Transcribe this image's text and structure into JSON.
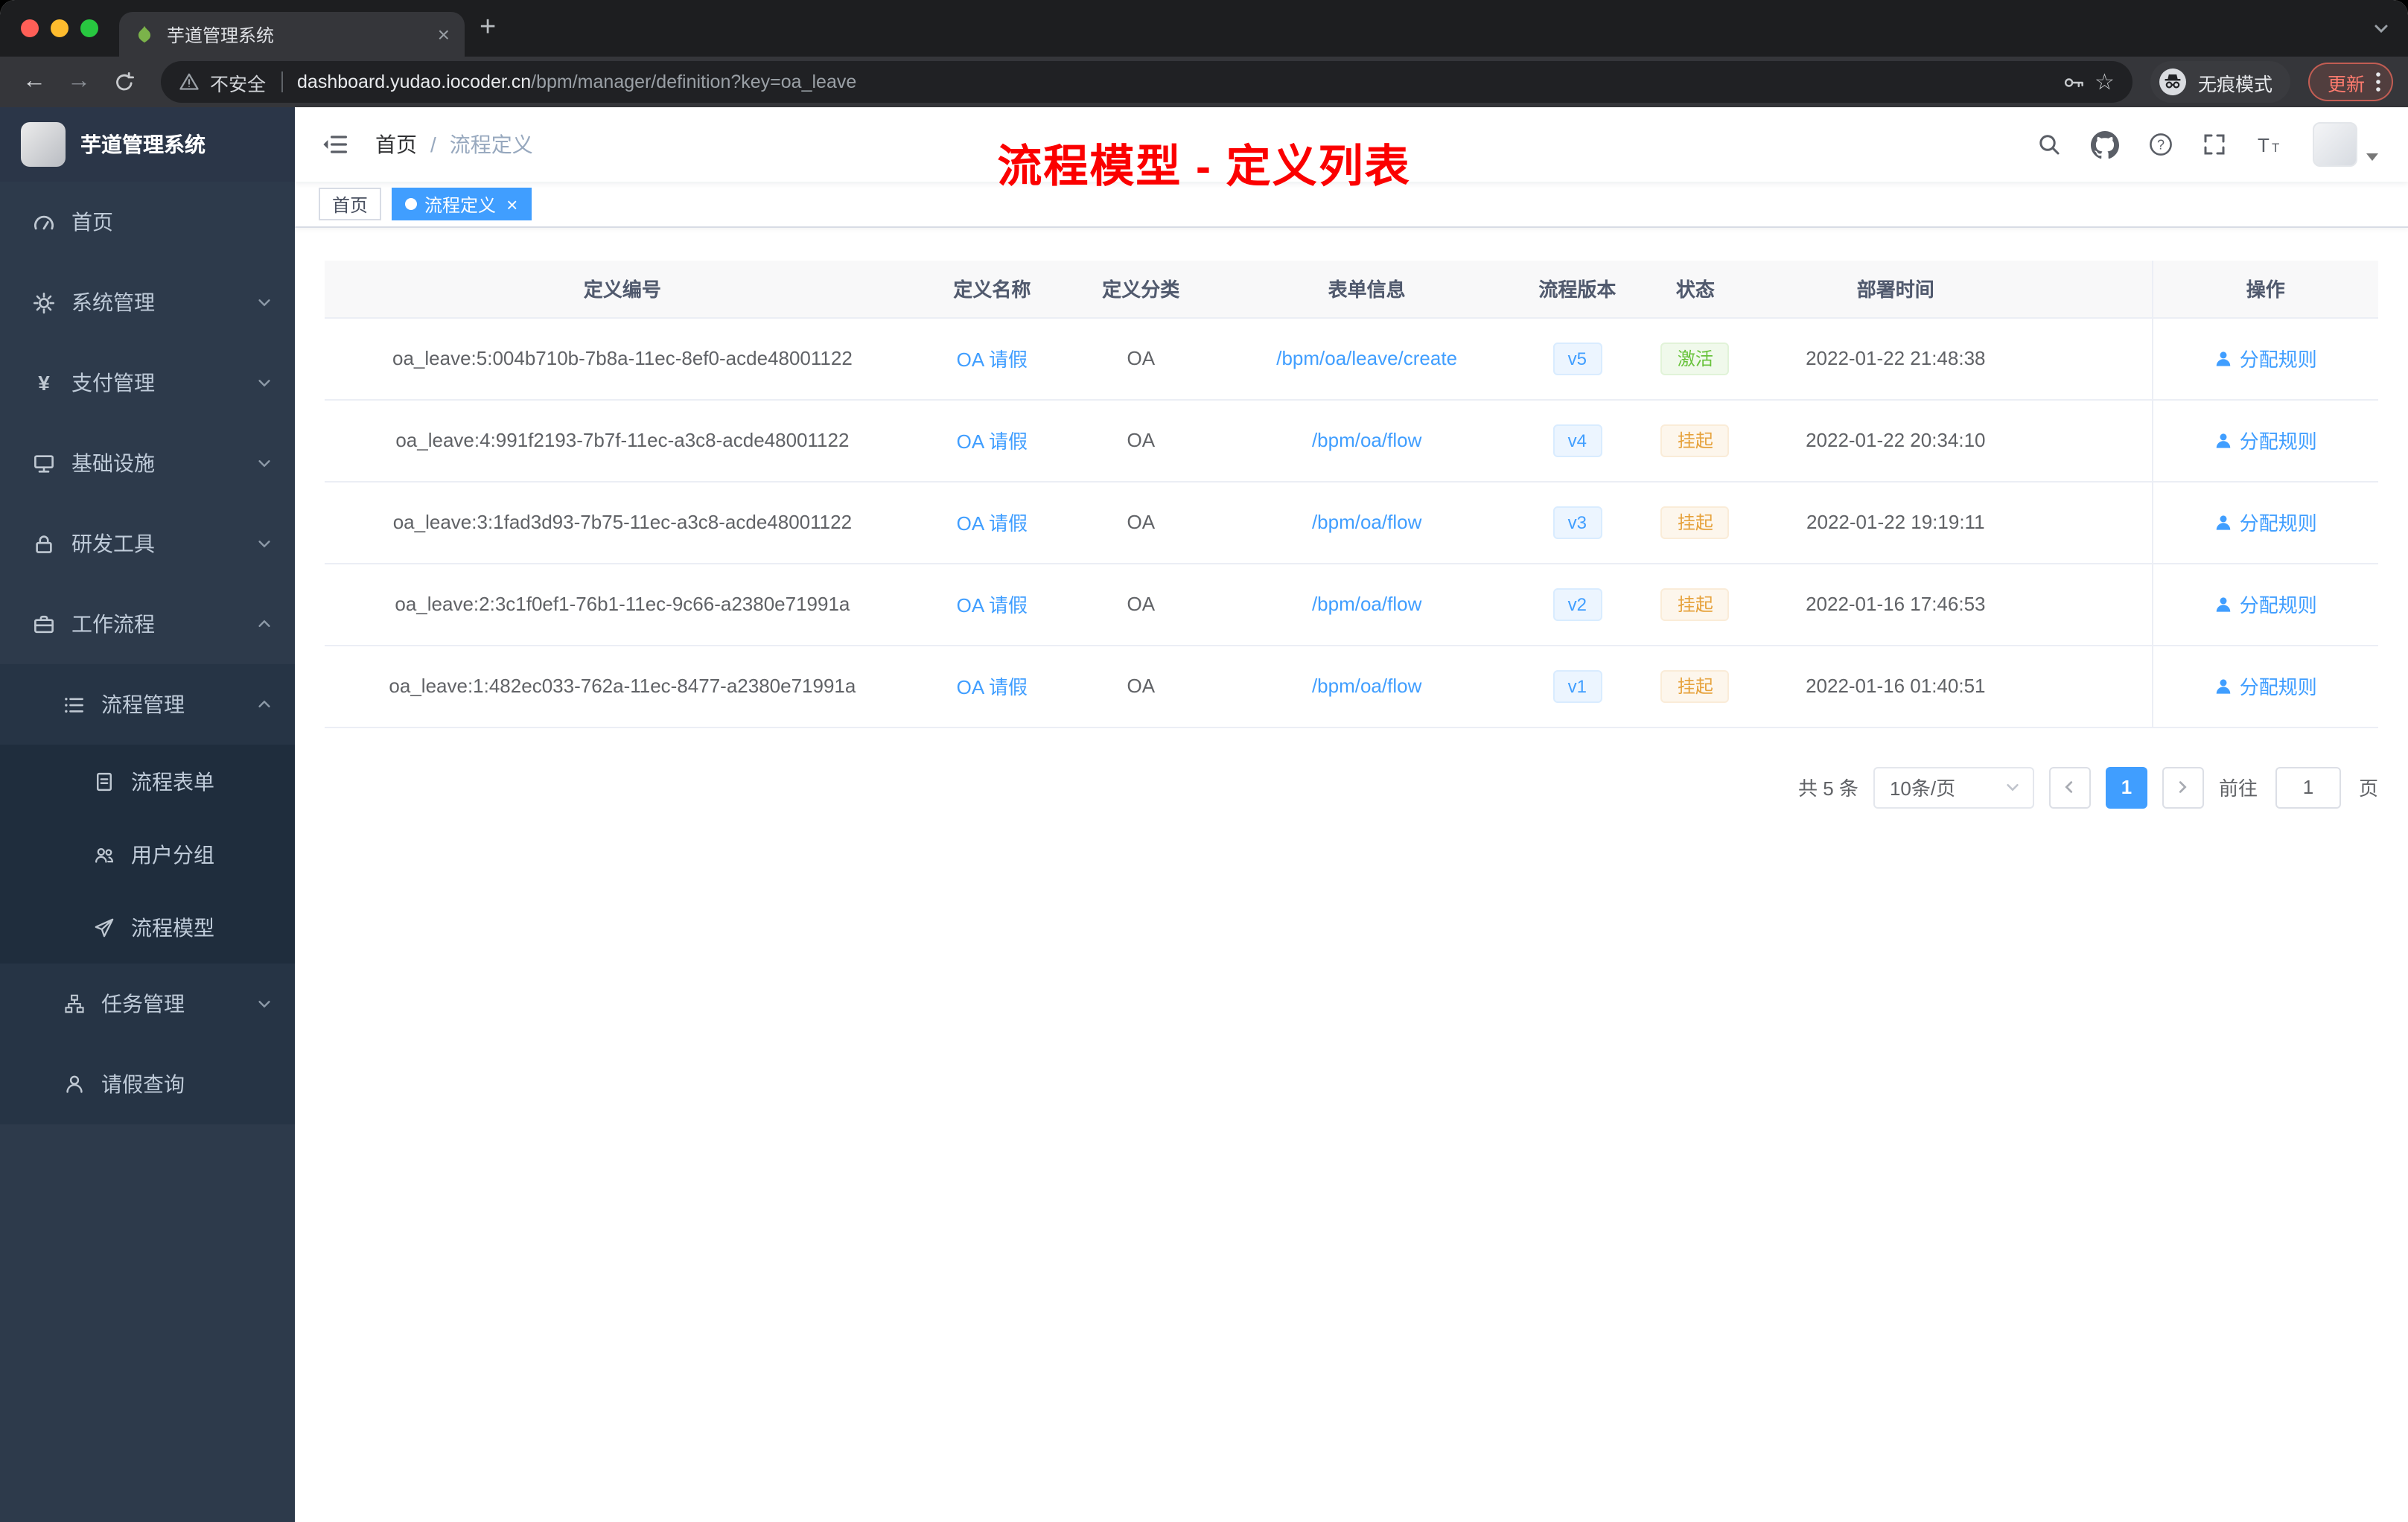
{
  "browser": {
    "tab_title": "芋道管理系统",
    "tab_close": "×",
    "new_tab_label": "+",
    "back_arrow": "←",
    "forward_arrow": "→",
    "security_label": "不安全",
    "url_host": "dashboard.yudao.iocoder.cn",
    "url_path": "/bpm/manager/definition?key=oa_leave",
    "star": "☆",
    "incognito_label": "无痕模式",
    "update_label": "更新"
  },
  "sidebar": {
    "logo_title": "芋道管理系统",
    "yen_glyph": "¥",
    "items": [
      {
        "label": "首页",
        "icon": "dashboard-icon"
      },
      {
        "label": "系统管理",
        "icon": "gear-icon"
      },
      {
        "label": "支付管理",
        "icon": "yen-icon"
      },
      {
        "label": "基础设施",
        "icon": "monitor-icon"
      },
      {
        "label": "研发工具",
        "icon": "lock-icon"
      },
      {
        "label": "工作流程",
        "icon": "briefcase-icon"
      },
      {
        "label": "流程管理",
        "icon": "list-icon"
      },
      {
        "label": "流程表单",
        "icon": "document-icon"
      },
      {
        "label": "用户分组",
        "icon": "user-group-icon"
      },
      {
        "label": "流程模型",
        "icon": "send-icon"
      },
      {
        "label": "任务管理",
        "icon": "tree-icon"
      },
      {
        "label": "请假查询",
        "icon": "user-icon"
      }
    ]
  },
  "navbar": {
    "breadcrumb_home": "首页",
    "breadcrumb_separator": "/",
    "breadcrumb_current": "流程定义",
    "overlay_title": "流程模型 - 定义列表"
  },
  "tags": {
    "home": "首页",
    "current": "流程定义",
    "close": "×"
  },
  "table": {
    "columns": [
      "定义编号",
      "定义名称",
      "定义分类",
      "表单信息",
      "流程版本",
      "状态",
      "部署时间",
      "操作"
    ],
    "rows": [
      {
        "id": "oa_leave:5:004b710b-7b8a-11ec-8ef0-acde48001122",
        "name": "OA 请假",
        "category": "OA",
        "form": "/bpm/oa/leave/create",
        "version": "v5",
        "status": "激活",
        "status_type": "success",
        "time": "2022-01-22 21:48:38",
        "action": "分配规则"
      },
      {
        "id": "oa_leave:4:991f2193-7b7f-11ec-a3c8-acde48001122",
        "name": "OA 请假",
        "category": "OA",
        "form": "/bpm/oa/flow",
        "version": "v4",
        "status": "挂起",
        "status_type": "warning",
        "time": "2022-01-22 20:34:10",
        "action": "分配规则"
      },
      {
        "id": "oa_leave:3:1fad3d93-7b75-11ec-a3c8-acde48001122",
        "name": "OA 请假",
        "category": "OA",
        "form": "/bpm/oa/flow",
        "version": "v3",
        "status": "挂起",
        "status_type": "warning",
        "time": "2022-01-22 19:19:11",
        "action": "分配规则"
      },
      {
        "id": "oa_leave:2:3c1f0ef1-76b1-11ec-9c66-a2380e71991a",
        "name": "OA 请假",
        "category": "OA",
        "form": "/bpm/oa/flow",
        "version": "v2",
        "status": "挂起",
        "status_type": "warning",
        "time": "2022-01-16 17:46:53",
        "action": "分配规则"
      },
      {
        "id": "oa_leave:1:482ec033-762a-11ec-8477-a2380e71991a",
        "name": "OA 请假",
        "category": "OA",
        "form": "/bpm/oa/flow",
        "version": "v1",
        "status": "挂起",
        "status_type": "warning",
        "time": "2022-01-16 01:40:51",
        "action": "分配规则"
      }
    ]
  },
  "pagination": {
    "total": "共 5 条",
    "page_size": "10条/页",
    "page": "1",
    "goto_prefix": "前往",
    "goto_value": "1",
    "goto_suffix": "页"
  },
  "colors": {
    "accent": "#409eff",
    "success": "#67c23a",
    "warning": "#e6a23c",
    "annotation": "#fb0000"
  }
}
